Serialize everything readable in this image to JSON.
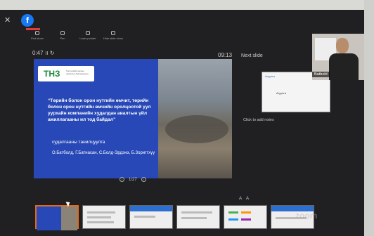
{
  "facebook_icon": "f",
  "toolbar": [
    {
      "label": "End show",
      "icon": "end-show-icon"
    },
    {
      "label": "Pen",
      "icon": "pen-icon"
    },
    {
      "label": "Laser pointer",
      "icon": "laser-icon"
    },
    {
      "label": "Hide slide show",
      "icon": "hide-icon"
    }
  ],
  "timers": {
    "elapsed": "0:47",
    "clock": "09:13"
  },
  "next_slide_label": "Next slide",
  "slide": {
    "logo": "ТНЗ",
    "logo_sub": "Төгсгөлийн шатны захирлын бүрэлдэхүүн",
    "title": "“Төрийн болон орон нутгийн өмчит, төрийн болон орон нутгийн өмчийн оролцоотой уул уурхайн компанийн худалдан авалтын үйл ажиллагааны ил тод байдал”",
    "subtitle": "судалгааны танилцуулга",
    "authors": "О.Батболд, Г.Батнасан, С.Болд-Эрдэнэ, Б.Зоригтхүү"
  },
  "pager": {
    "text": "1/27",
    "prev": "‹",
    "next": "›"
  },
  "next_slide": {
    "logo": "Агуулга",
    "text": "Агуулга"
  },
  "notes_placeholder": "Click to add notes",
  "font_controls": {
    "increase": "A",
    "decrease": "A"
  },
  "webcam_name": "Batbold",
  "watermark": "zoom",
  "accent": "#e06a1f"
}
